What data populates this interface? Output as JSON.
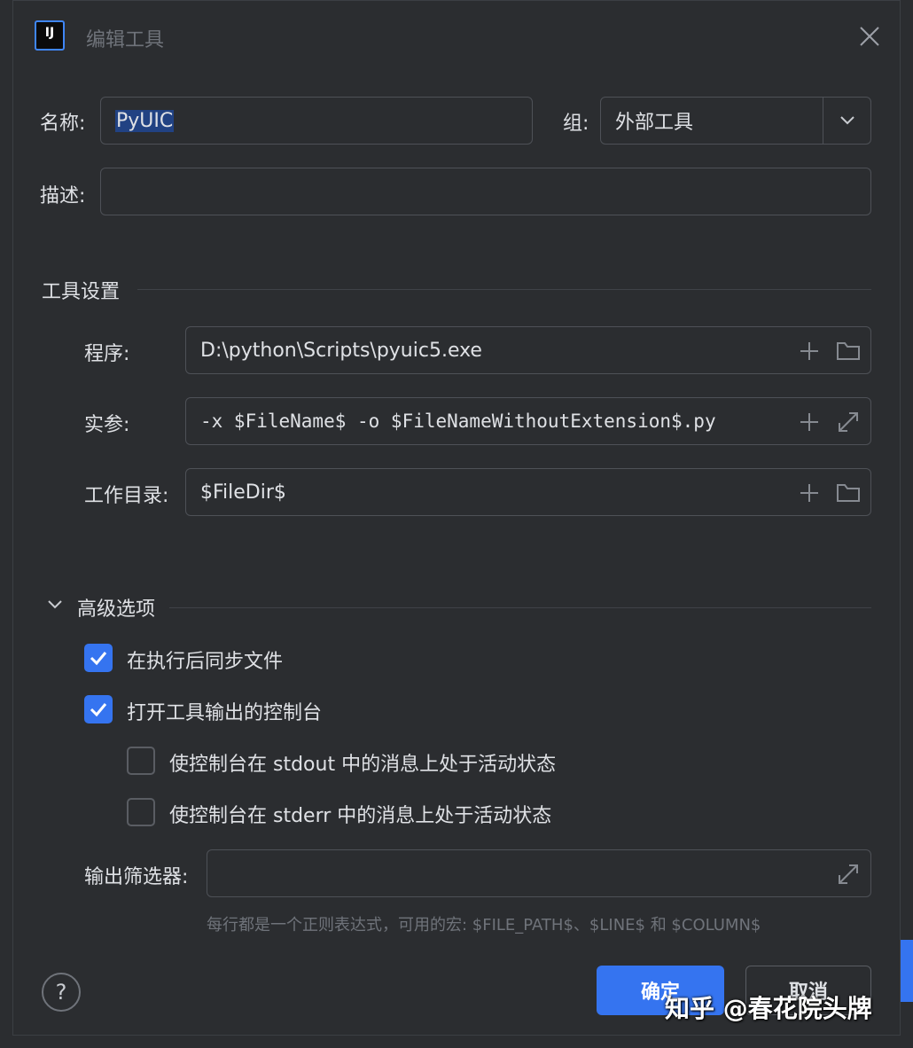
{
  "window": {
    "title": "编辑工具",
    "logo_text": "IJ"
  },
  "form": {
    "name_label": "名称:",
    "name_value": "PyUIC",
    "group_label": "组:",
    "group_value": "外部工具",
    "description_label": "描述:",
    "description_value": ""
  },
  "tool_settings": {
    "section_title": "工具设置",
    "program_label": "程序:",
    "program_value": "D:\\python\\Scripts\\pyuic5.exe",
    "arguments_label": "实参:",
    "arguments_value": "-x $FileName$ -o $FileNameWithoutExtension$.py",
    "workdir_label": "工作目录:",
    "workdir_value": "$FileDir$"
  },
  "advanced": {
    "section_title": "高级选项",
    "sync_files_label": "在执行后同步文件",
    "sync_files_checked": true,
    "open_console_label": "打开工具输出的控制台",
    "open_console_checked": true,
    "stdout_label": "使控制台在 stdout 中的消息上处于活动状态",
    "stdout_checked": false,
    "stderr_label": "使控制台在 stderr 中的消息上处于活动状态",
    "stderr_checked": false,
    "output_filter_label": "输出筛选器:",
    "output_filter_value": "",
    "hint": "每行都是一个正则表达式，可用的宏: $FILE_PATH$、$LINE$ 和 $COLUMN$"
  },
  "buttons": {
    "help": "?",
    "ok": "确定",
    "cancel": "取消"
  },
  "watermark": "知乎 @春花院头牌",
  "colors": {
    "background": "#2b2d30",
    "accent": "#3574f0",
    "border": "#4e5157",
    "text": "#dfe1e5",
    "muted": "#6f737a"
  }
}
